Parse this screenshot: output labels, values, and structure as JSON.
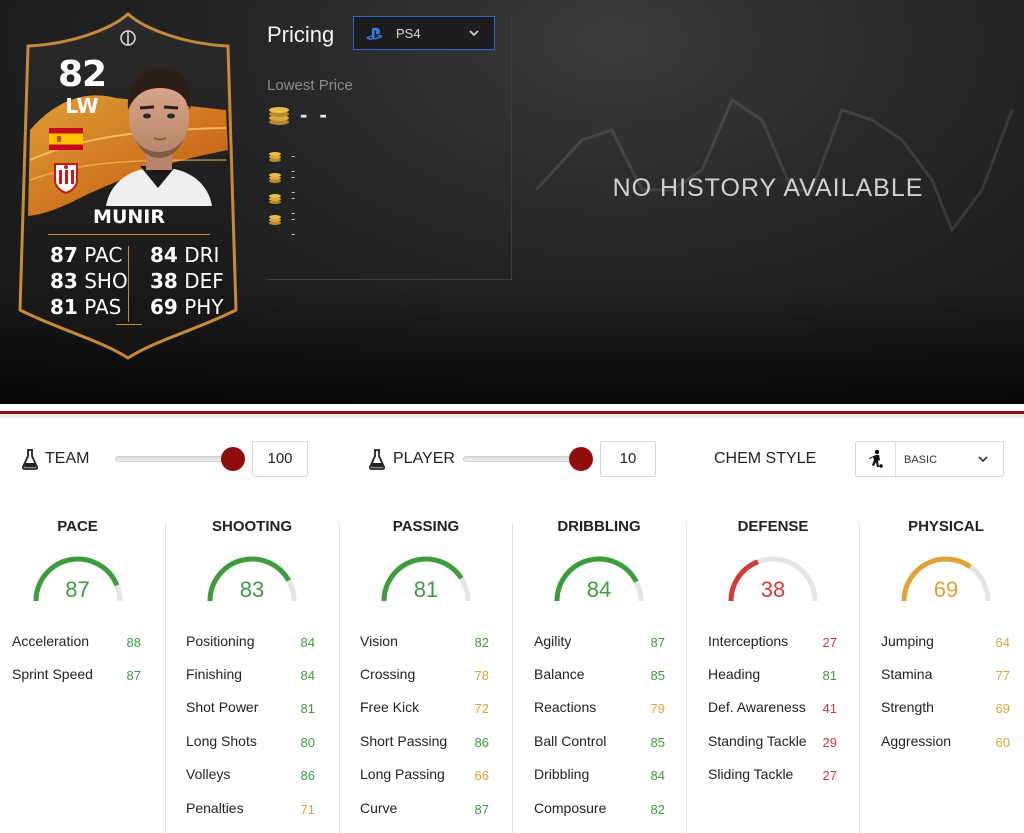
{
  "card": {
    "rating": "82",
    "position": "LW",
    "name": "MUNIR",
    "stats_left": [
      {
        "value": "87",
        "label": "PAC"
      },
      {
        "value": "83",
        "label": "SHO"
      },
      {
        "value": "81",
        "label": "PAS"
      }
    ],
    "stats_right": [
      {
        "value": "84",
        "label": "DRI"
      },
      {
        "value": "38",
        "label": "DEF"
      },
      {
        "value": "69",
        "label": "PHY"
      }
    ],
    "colors": {
      "border": "#c68a3a",
      "background": "#1a1a1a",
      "accent": "#f28a12"
    }
  },
  "pricing": {
    "title": "Pricing",
    "platform": "PS4",
    "lowest_label": "Lowest Price",
    "lowest_value": "- -",
    "other_prices": [
      "- -",
      "- -",
      "- -",
      "- -"
    ]
  },
  "history": {
    "message": "NO HISTORY AVAILABLE"
  },
  "chem": {
    "team_label": "TEAM",
    "team_value": "100",
    "team_level": 1.0,
    "player_label": "PLAYER",
    "player_value": "10",
    "player_level": 1.0,
    "style_label": "CHEM STYLE",
    "style_value": "BASIC"
  },
  "colors": {
    "green": "#3e9c3f",
    "yellow": "#e0a235",
    "red": "#d23b3b",
    "slider_knob": "#8f0d0d",
    "separator": "#8f0d0d"
  },
  "columns": [
    {
      "title": "PACE",
      "value": "87",
      "grade": "green",
      "attributes": [
        {
          "name": "Acceleration",
          "value": "88",
          "grade": "green"
        },
        {
          "name": "Sprint Speed",
          "value": "87",
          "grade": "green"
        }
      ]
    },
    {
      "title": "SHOOTING",
      "value": "83",
      "grade": "green",
      "attributes": [
        {
          "name": "Positioning",
          "value": "84",
          "grade": "green"
        },
        {
          "name": "Finishing",
          "value": "84",
          "grade": "green"
        },
        {
          "name": "Shot Power",
          "value": "81",
          "grade": "green"
        },
        {
          "name": "Long Shots",
          "value": "80",
          "grade": "green"
        },
        {
          "name": "Volleys",
          "value": "86",
          "grade": "green"
        },
        {
          "name": "Penalties",
          "value": "71",
          "grade": "yellow"
        }
      ]
    },
    {
      "title": "PASSING",
      "value": "81",
      "grade": "green",
      "attributes": [
        {
          "name": "Vision",
          "value": "82",
          "grade": "green"
        },
        {
          "name": "Crossing",
          "value": "78",
          "grade": "yellow"
        },
        {
          "name": "Free Kick",
          "value": "72",
          "grade": "yellow"
        },
        {
          "name": "Short Passing",
          "value": "86",
          "grade": "green"
        },
        {
          "name": "Long Passing",
          "value": "66",
          "grade": "yellow"
        },
        {
          "name": "Curve",
          "value": "87",
          "grade": "green"
        }
      ]
    },
    {
      "title": "DRIBBLING",
      "value": "84",
      "grade": "green",
      "attributes": [
        {
          "name": "Agility",
          "value": "87",
          "grade": "green"
        },
        {
          "name": "Balance",
          "value": "85",
          "grade": "green"
        },
        {
          "name": "Reactions",
          "value": "79",
          "grade": "yellow"
        },
        {
          "name": "Ball Control",
          "value": "85",
          "grade": "green"
        },
        {
          "name": "Dribbling",
          "value": "84",
          "grade": "green"
        },
        {
          "name": "Composure",
          "value": "82",
          "grade": "green"
        }
      ]
    },
    {
      "title": "DEFENSE",
      "value": "38",
      "grade": "red",
      "attributes": [
        {
          "name": "Interceptions",
          "value": "27",
          "grade": "red"
        },
        {
          "name": "Heading",
          "value": "81",
          "grade": "green"
        },
        {
          "name": "Def. Awareness",
          "value": "41",
          "grade": "red"
        },
        {
          "name": "Standing Tackle",
          "value": "29",
          "grade": "red"
        },
        {
          "name": "Sliding Tackle",
          "value": "27",
          "grade": "red"
        }
      ]
    },
    {
      "title": "PHYSICAL",
      "value": "69",
      "grade": "yellow",
      "attributes": [
        {
          "name": "Jumping",
          "value": "64",
          "grade": "yellow"
        },
        {
          "name": "Stamina",
          "value": "77",
          "grade": "yellow"
        },
        {
          "name": "Strength",
          "value": "69",
          "grade": "yellow"
        },
        {
          "name": "Aggression",
          "value": "60",
          "grade": "yellow"
        }
      ]
    }
  ]
}
